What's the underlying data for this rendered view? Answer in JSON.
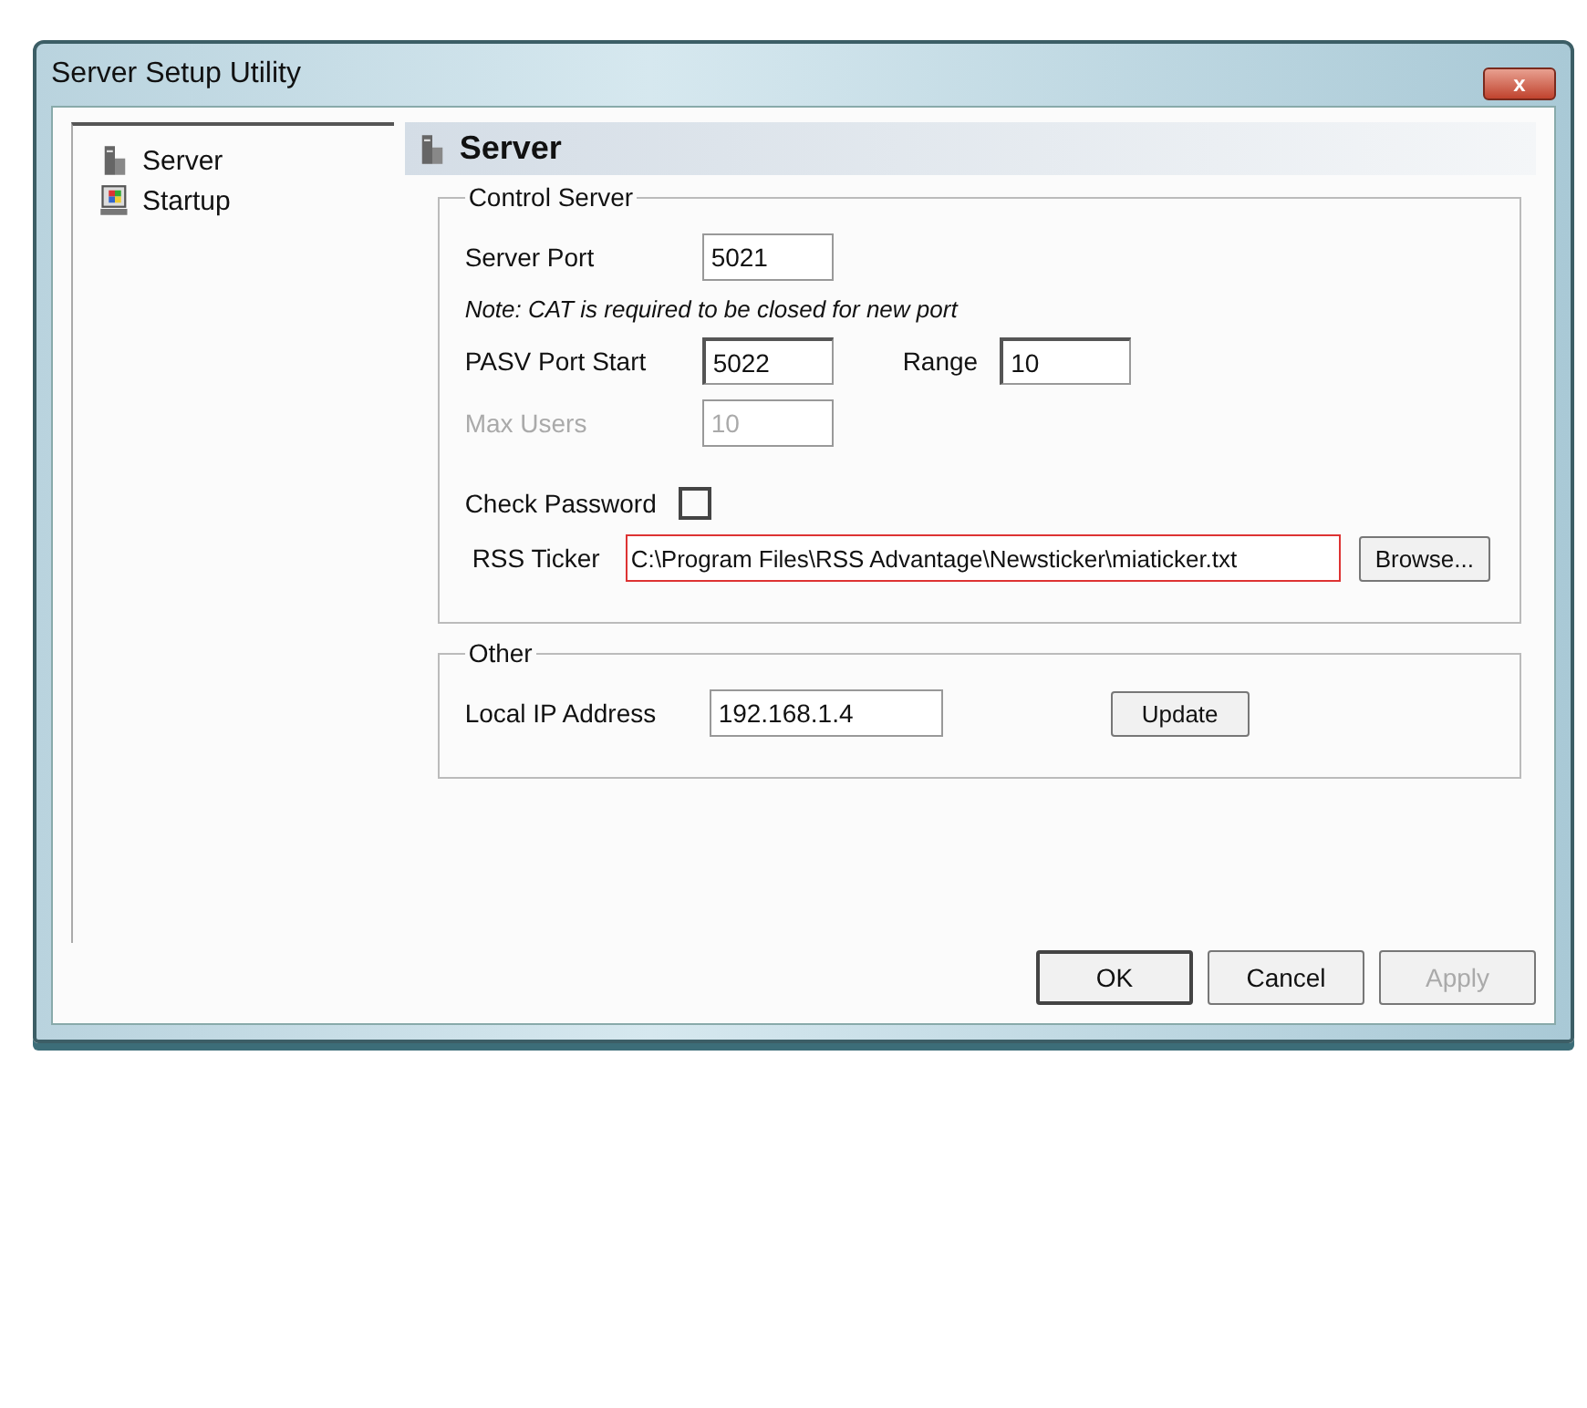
{
  "window": {
    "title": "Server Setup Utility",
    "close": "x"
  },
  "tree": [
    {
      "label": "Server"
    },
    {
      "label": "Startup"
    }
  ],
  "panel": {
    "title": "Server",
    "control_server": {
      "legend": "Control Server",
      "server_port": {
        "label": "Server Port",
        "value": "5021"
      },
      "note": "Note: CAT is required to be closed  for new port",
      "pasv_port_start": {
        "label": "PASV Port Start",
        "value": "5022"
      },
      "range": {
        "label": "Range",
        "value": "10"
      },
      "max_users": {
        "label": "Max Users",
        "value": "10",
        "disabled": true
      },
      "check_password": {
        "label": "Check Password",
        "checked": false
      },
      "rss_ticker": {
        "label": "RSS Ticker",
        "value": "C:\\Program Files\\RSS Advantage\\Newsticker\\miaticker.txt",
        "invalid": true,
        "button": "Browse..."
      }
    },
    "other": {
      "legend": "Other",
      "local_ip": {
        "label": "Local IP Address",
        "value": "192.168.1.4",
        "button": "Update"
      }
    }
  },
  "buttons": [
    {
      "label": "OK",
      "disabled": false
    },
    {
      "label": "Cancel",
      "disabled": false
    },
    {
      "label": "Apply",
      "disabled": true
    }
  ]
}
